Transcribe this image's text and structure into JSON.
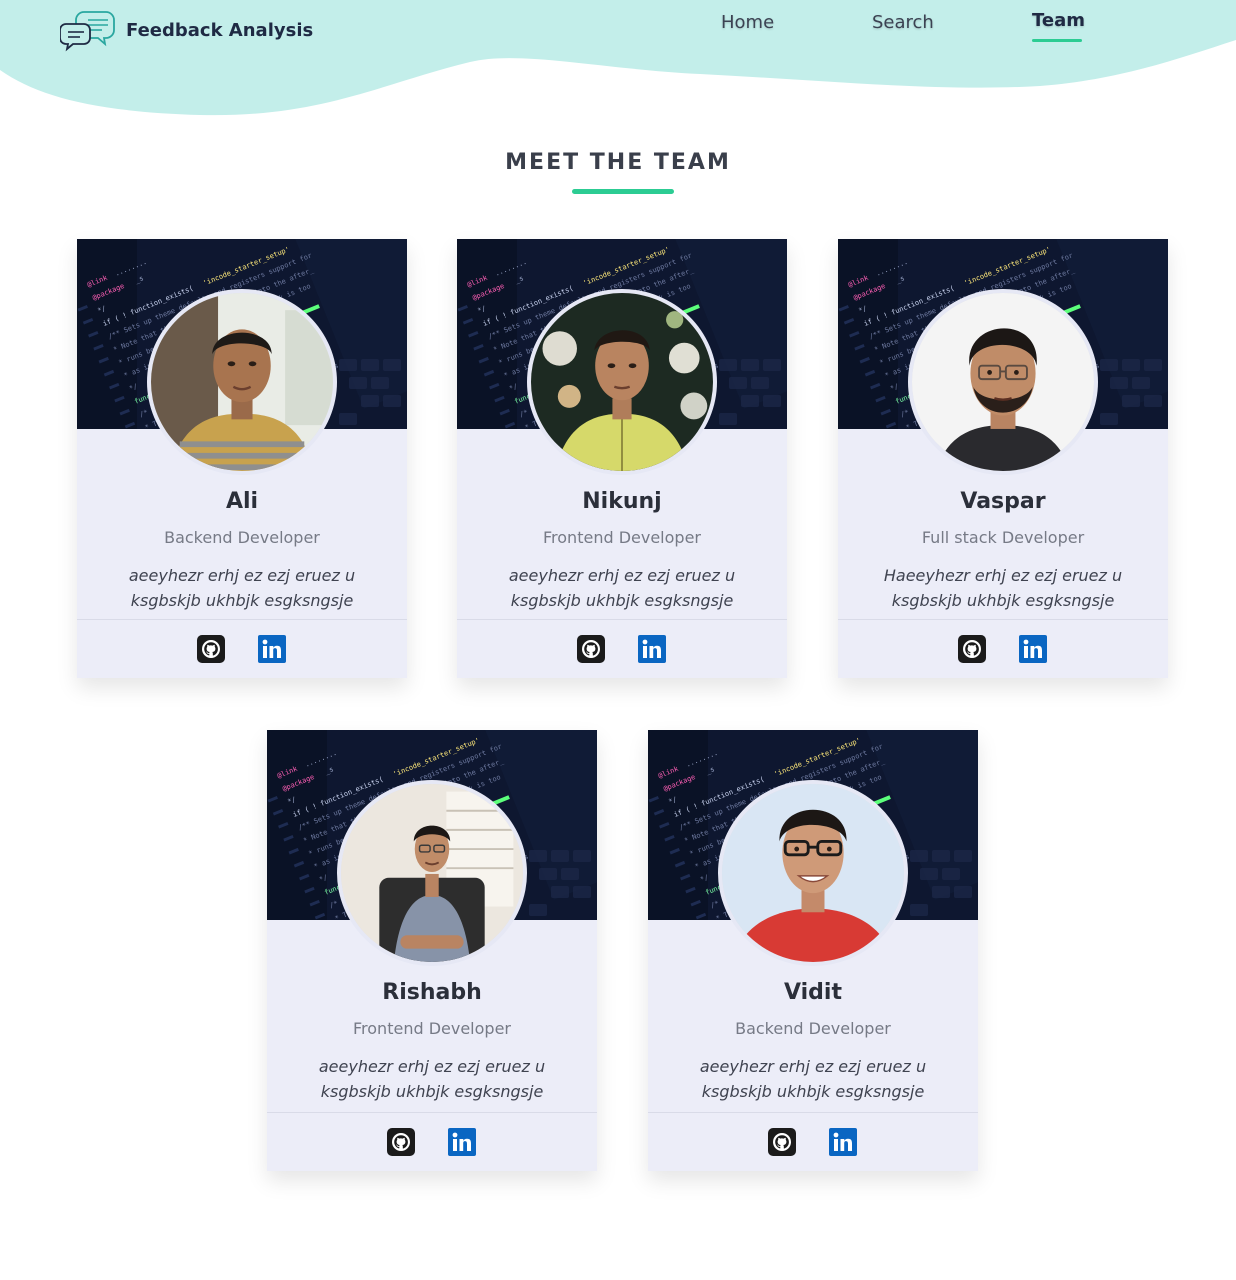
{
  "header": {
    "brand_name": "Feedback Analysis",
    "nav": [
      {
        "label": "Home",
        "active": false
      },
      {
        "label": "Search",
        "active": false
      },
      {
        "label": "Team",
        "active": true
      }
    ]
  },
  "colors": {
    "header_bg": "#c3eeea",
    "accent": "#2ccc93",
    "card_bg": "#ecedf8",
    "github": "#1b1b1b",
    "linkedin": "#0a66c2"
  },
  "section": {
    "title": "MEET THE TEAM"
  },
  "team": [
    {
      "name": "Ali",
      "role": "Backend Developer",
      "bio": "aeeyhezr erhj ez ezj eruez u ksgbskjb ukhbjk esgksngsje",
      "icons": [
        "github-icon",
        "linkedin-icon"
      ]
    },
    {
      "name": "Nikunj",
      "role": "Frontend Developer",
      "bio": "aeeyhezr erhj ez ezj eruez u ksgbskjb ukhbjk esgksngsje",
      "icons": [
        "github-icon",
        "linkedin-icon"
      ]
    },
    {
      "name": "Vaspar",
      "role": "Full stack Developer",
      "bio": "Haeeyhezr erhj ez ezj eruez u ksgbskjb ukhbjk esgksngsje",
      "icons": [
        "github-icon",
        "linkedin-icon"
      ]
    },
    {
      "name": "Rishabh",
      "role": "Frontend Developer",
      "bio": "aeeyhezr erhj ez ezj eruez u ksgbskjb ukhbjk esgksngsje",
      "icons": [
        "github-icon",
        "linkedin-icon"
      ]
    },
    {
      "name": "Vidit",
      "role": "Backend Developer",
      "bio": "aeeyhezr erhj ez ezj eruez u ksgbskjb ukhbjk esgksngsje",
      "icons": [
        "github-icon",
        "linkedin-icon"
      ]
    }
  ]
}
